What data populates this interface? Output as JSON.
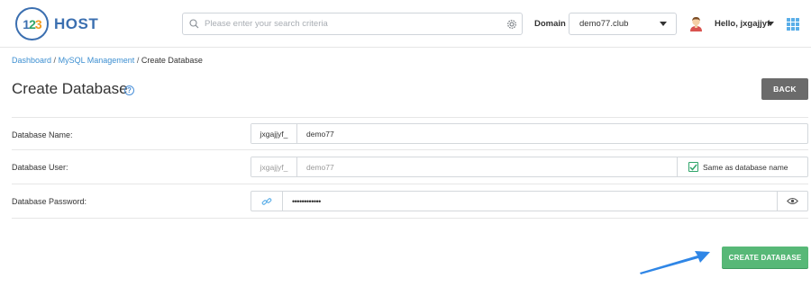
{
  "brand": {
    "digit1": "1",
    "digit2": "2",
    "digit3": "3",
    "name": "HOST"
  },
  "search": {
    "placeholder": "Please enter your search criteria"
  },
  "domain": {
    "label": "Domain",
    "selected": "demo77.club"
  },
  "user": {
    "greeting": "Hello, jxgajjyf"
  },
  "breadcrumb": {
    "items": [
      "Dashboard",
      "MySQL Management",
      "Create Database"
    ],
    "separator": "/"
  },
  "page": {
    "title": "Create Database",
    "help_glyph": "?"
  },
  "buttons": {
    "back": "BACK",
    "create": "CREATE DATABASE"
  },
  "form": {
    "db_name": {
      "label": "Database Name:",
      "prefix": "jxgajjyf_",
      "value": "demo77"
    },
    "db_user": {
      "label": "Database User:",
      "prefix": "jxgajjyf_",
      "value": "demo77",
      "same_label": "Same as database name",
      "same_checked": true
    },
    "db_password": {
      "label": "Database Password:",
      "value": "••••••••••••"
    }
  },
  "colors": {
    "accent_blue": "#3d8fd1",
    "create_green": "#57b877",
    "back_gray": "#6b6b6b",
    "arrow_blue": "#2f86e6"
  },
  "icons": [
    "search-icon",
    "gear-icon",
    "caret-down-icon",
    "avatar-icon",
    "apps-grid-icon",
    "help-icon",
    "checkbox-check-icon",
    "link-generate-icon",
    "eye-icon",
    "pointer-arrow-icon"
  ]
}
